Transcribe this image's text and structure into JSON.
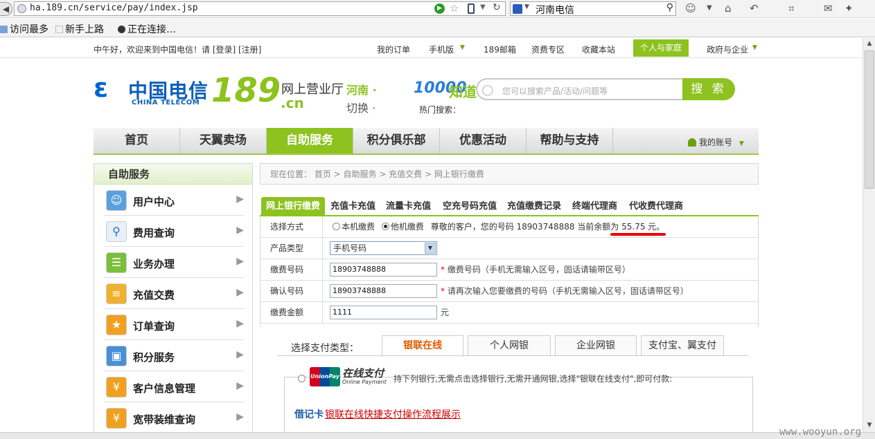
{
  "browser": {
    "url": "ha.189.cn/service/pay/index.jsp",
    "search_value": "河南电信",
    "bookmarks": [
      "访问最多",
      "新手上路",
      "正在连接…"
    ]
  },
  "topbar": {
    "greeting": "中午好，欢迎来到中国电信！请 [登录]  [注册]",
    "links": [
      "我的订单",
      "手机版",
      "189邮箱",
      "资费专区",
      "收藏本站",
      "个人与家庭",
      "政府与企业"
    ]
  },
  "header": {
    "logo_cn": "中国电信",
    "logo_en": "CHINA TELECOM",
    "logo_num": "189",
    "logo_hall": "网上营业厅",
    "logo_domain": ".cn",
    "region": "河南 ·",
    "switch": "切换 ·",
    "know_num": "10000",
    "know_txt": "知道",
    "search_placeholder": "您可以搜索产品/活动/问题等",
    "search_button": "搜 索",
    "hot_search": "热门搜索："
  },
  "nav": {
    "items": [
      "首页",
      "天翼卖场",
      "自助服务",
      "积分俱乐部",
      "优惠活动",
      "帮助与支持"
    ],
    "account": "我的账号"
  },
  "sidebar": {
    "title": "自助服务",
    "items": [
      "用户中心",
      "费用查询",
      "业务办理",
      "充值交费",
      "订单查询",
      "积分服务",
      "客户信息管理",
      "宽带装维查询"
    ]
  },
  "breadcrumb": "现在位置： 首页  >  自助服务  >  充值交费  >  网上银行缴费",
  "tabs": [
    "网上银行缴费",
    "充值卡充值",
    "流量卡充值",
    "空充号码充值",
    "充值缴费记录",
    "终端代理商",
    "代收费代理商"
  ],
  "form": {
    "mode_label": "选择方式",
    "mode_opt1": "本机缴费",
    "mode_opt2": "他机缴费",
    "mode_text": "尊敬的客户，您的号码 18903748888 当前余额为 ",
    "balance": "55.75 元。",
    "product_label": "产品类型",
    "product_value": "手机号码",
    "pay_num_label": "缴费号码",
    "pay_num_value": "18903748888",
    "pay_num_note": "缴费号码（手机无需输入区号，固话请输带区号）",
    "confirm_label": "确认号码",
    "confirm_value": "18903748888",
    "confirm_note": "请再次输入您要缴费的号码（手机无需输入区号，固话请带区号）",
    "amount_label": "缴费金额",
    "amount_value": "1111",
    "amount_unit": "元",
    "required_mark": "*"
  },
  "payment": {
    "type_label": "选择支付类型：",
    "types": [
      "银联在线",
      "个人网银",
      "企业网银",
      "支付宝、翼支付"
    ],
    "unionpay_logo": "UnionPay 银联",
    "unionpay_title": "在线支付",
    "unionpay_sub": "Online Payment",
    "unionpay_desc": "持下列银行,无需点击选择银行,无需开通网银,选择\"银联在线支付\",即可付款:",
    "debit_label": "借记卡",
    "debit_link": "银联在线快捷支付操作流程展示"
  },
  "watermark": "www.wooyun.org",
  "colors": {
    "brand_green": "#8dc21f",
    "brand_blue": "#0b5fb5",
    "alert_red": "#e00000"
  }
}
